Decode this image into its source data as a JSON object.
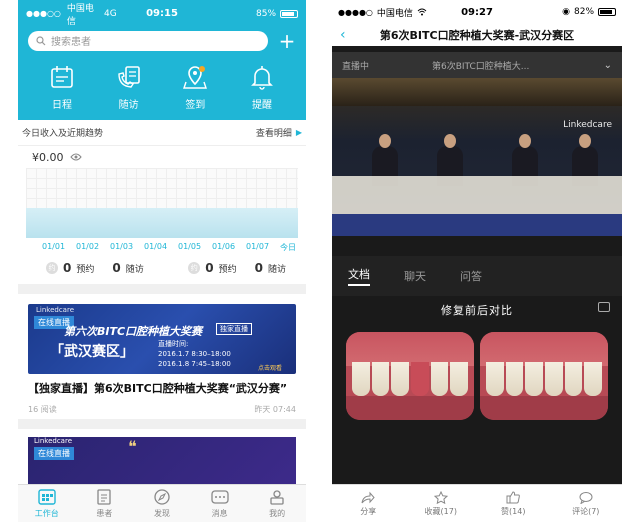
{
  "left": {
    "status": {
      "carrier": "中国电信",
      "network": "4G",
      "time": "09:15",
      "battery": "85%"
    },
    "search_placeholder": "搜索患者",
    "quick_actions": [
      {
        "label": "日程",
        "icon": "calendar-icon"
      },
      {
        "label": "随访",
        "icon": "phone-list-icon"
      },
      {
        "label": "签到",
        "icon": "checkin-icon"
      },
      {
        "label": "提醒",
        "icon": "bell-icon"
      }
    ],
    "income": {
      "section_title": "今日收入及近期趋势",
      "detail_link": "查看明细",
      "amount": "¥0.00",
      "dates": [
        "01/01",
        "01/02",
        "01/03",
        "01/04",
        "01/05",
        "01/06",
        "01/07",
        "今日"
      ],
      "stats": [
        {
          "badge": "约",
          "value": "0",
          "label": "预约"
        },
        {
          "value": "0",
          "label": "随访"
        },
        {
          "badge": "约",
          "value": "0",
          "label": "预约"
        },
        {
          "value": "0",
          "label": "随访"
        }
      ]
    },
    "news": [
      {
        "brand": "Linkedcare",
        "tag": "在线直播",
        "banner_title": "第六次BITC口腔种植大奖赛",
        "banner_badge": "独家直播",
        "banner_city": "「武汉赛区」",
        "banner_time_label": "直播时间:",
        "banner_time_1": "2016.1.7  8:30–18:00",
        "banner_time_2": "2016.1.8  7:45–18:00",
        "banner_watch": "点击观看",
        "title": "【独家直播】第6次BITC口腔种植大奖赛“武汉分赛”",
        "reads": "16 阅读",
        "time": "昨天 07:44"
      },
      {
        "brand": "Linkedcare",
        "tag": "在线直播"
      }
    ],
    "tabs": [
      {
        "label": "工作台",
        "icon": "workbench-icon",
        "active": true
      },
      {
        "label": "患者",
        "icon": "patient-icon",
        "active": false
      },
      {
        "label": "发现",
        "icon": "compass-icon",
        "active": false
      },
      {
        "label": "消息",
        "icon": "message-icon",
        "active": false
      },
      {
        "label": "我的",
        "icon": "profile-icon",
        "active": false
      }
    ],
    "accent": "#1fb6d6"
  },
  "right": {
    "status": {
      "carrier": "中国电信",
      "time": "09:27",
      "battery": "82%"
    },
    "nav_title": "第6次BITC口腔种植大奖赛-武汉分赛区",
    "live_status": "直播中",
    "live_title": "第6次BITC口腔种植大...",
    "video_logo": "Linkedcare",
    "doc_tabs": [
      "文档",
      "聊天",
      "问答"
    ],
    "slide_title": "修复前后对比",
    "actions": [
      {
        "label": "分享",
        "icon": "share-icon"
      },
      {
        "label": "收藏(17)",
        "icon": "star-icon"
      },
      {
        "label": "赞(14)",
        "icon": "thumbs-up-icon"
      },
      {
        "label": "评论(7)",
        "icon": "comment-icon"
      }
    ]
  }
}
